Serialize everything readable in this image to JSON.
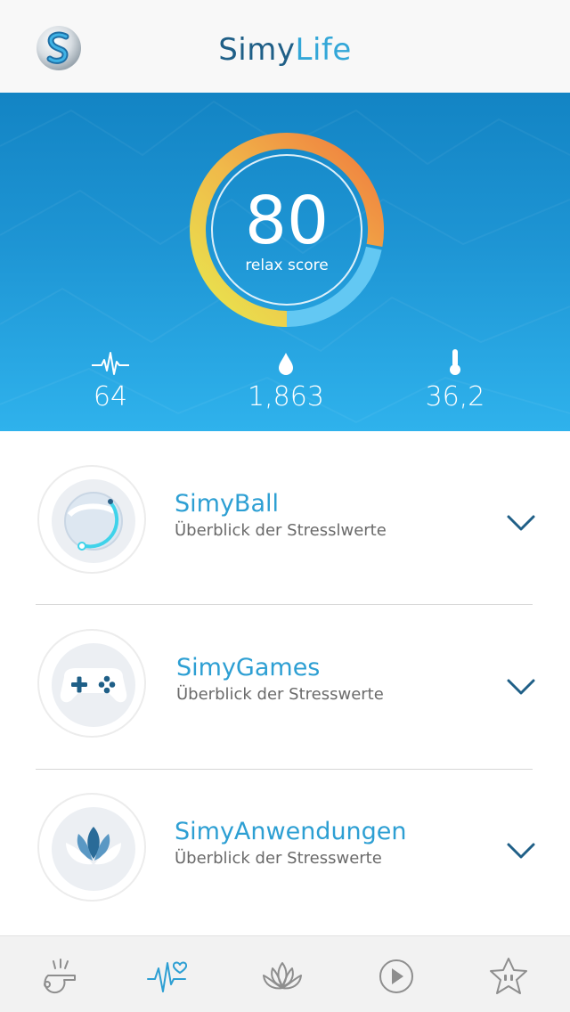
{
  "header": {
    "title_part1": "Simy",
    "title_part2": "Life"
  },
  "score": {
    "value": "80",
    "label": "relax score"
  },
  "metrics": [
    {
      "icon": "heartbeat-icon",
      "value": "64"
    },
    {
      "icon": "water-drop-icon",
      "value": "1,863"
    },
    {
      "icon": "thermometer-icon",
      "value": "36,2"
    }
  ],
  "cards": [
    {
      "title": "SimyBall",
      "subtitle": "Überblick der Stresslwerte",
      "icon": "ball-icon"
    },
    {
      "title": "SimyGames",
      "subtitle": "Überblick der Stresswerte",
      "icon": "gamepad-icon"
    },
    {
      "title": "SimyAnwendungen",
      "subtitle": "Überblick der Stresswerte",
      "icon": "lotus-icon"
    }
  ],
  "tabs": [
    {
      "icon": "whistle-icon",
      "active": false
    },
    {
      "icon": "heart-pulse-icon",
      "active": true
    },
    {
      "icon": "lotus-icon",
      "active": false
    },
    {
      "icon": "play-icon",
      "active": false
    },
    {
      "icon": "star-icon",
      "active": false
    }
  ],
  "colors": {
    "brand_dark": "#1f5f87",
    "brand_light": "#33a7d8",
    "hero_top": "#1384c4",
    "hero_bottom": "#2fb2ec",
    "gauge_yellow": "#e6e44f",
    "gauge_orange": "#f28a40",
    "gauge_blue": "#5cc6f2"
  }
}
